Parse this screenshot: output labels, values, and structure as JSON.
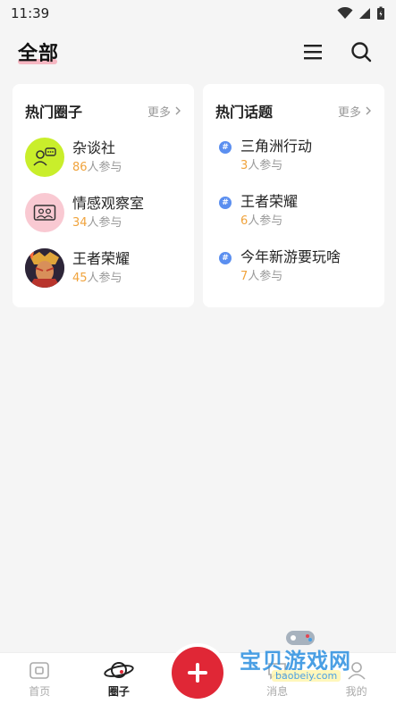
{
  "status_bar": {
    "time": "11:39"
  },
  "header": {
    "title": "全部"
  },
  "hot_circles": {
    "title": "热门圈子",
    "more": "更多",
    "items": [
      {
        "name": "杂谈社",
        "count": "86",
        "suffix": "人参与"
      },
      {
        "name": "情感观察室",
        "count": "34",
        "suffix": "人参与"
      },
      {
        "name": "王者荣耀",
        "count": "45",
        "suffix": "人参与"
      }
    ]
  },
  "hot_topics": {
    "title": "热门话题",
    "more": "更多",
    "items": [
      {
        "name": "三角洲行动",
        "count": "3",
        "suffix": "人参与"
      },
      {
        "name": "王者荣耀",
        "count": "6",
        "suffix": "人参与"
      },
      {
        "name": "今年新游要玩啥",
        "count": "7",
        "suffix": "人参与"
      }
    ]
  },
  "tabbar": {
    "tabs": [
      {
        "label": "首页"
      },
      {
        "label": "圈子"
      },
      {
        "label": "消息"
      },
      {
        "label": "我的"
      }
    ]
  },
  "watermark": {
    "text": "宝贝游戏网",
    "url": "baobeiy.com"
  },
  "colors": {
    "accent": "#e02736",
    "count": "#f0a33c",
    "topic": "#5b8ff0"
  }
}
